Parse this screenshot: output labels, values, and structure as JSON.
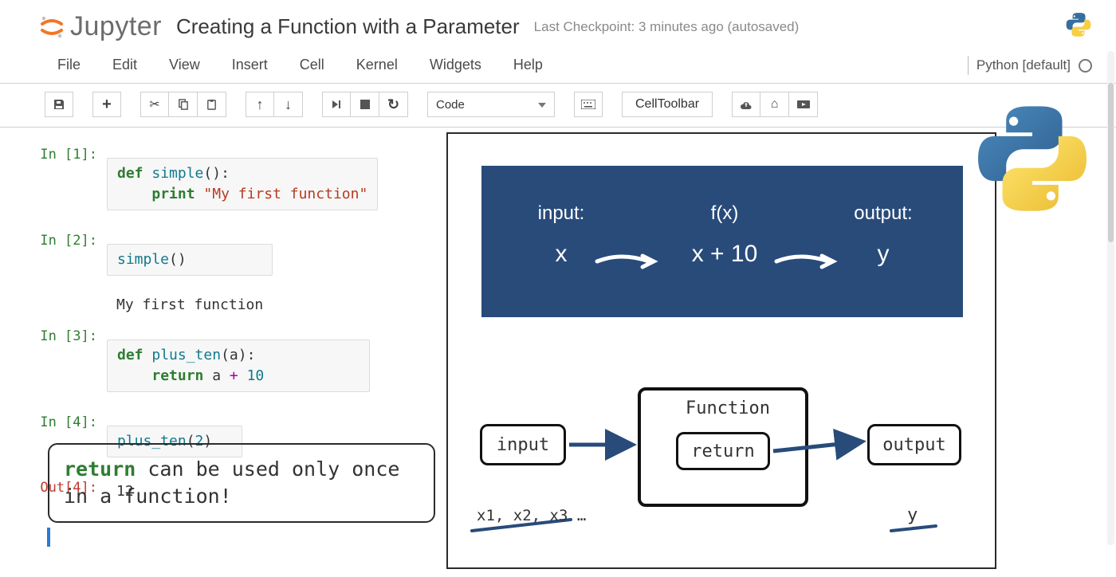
{
  "header": {
    "logo_text": "Jupyter",
    "title": "Creating a Function with a Parameter",
    "checkpoint": "Last Checkpoint: 3 minutes ago (autosaved)"
  },
  "menubar": {
    "items": [
      "File",
      "Edit",
      "View",
      "Insert",
      "Cell",
      "Kernel",
      "Widgets",
      "Help"
    ],
    "kernel_label": "Python [default]"
  },
  "toolbar": {
    "celltype": "Code",
    "celltoolbar_label": "CellToolbar",
    "icons": {
      "save": "save-icon",
      "add": "plus-icon",
      "cut": "scissors-icon",
      "copy": "copy-icon",
      "paste": "paste-icon",
      "up": "arrow-up-icon",
      "down": "arrow-down-icon",
      "run_step": "step-forward-icon",
      "stop": "stop-icon",
      "restart": "refresh-icon",
      "keyboard": "keyboard-icon",
      "cloud": "cloud-upload-icon",
      "gift": "gift-icon",
      "slides": "slides-icon"
    }
  },
  "cells": [
    {
      "prompt": "In [1]:",
      "code_html": "<span class='kw'>def</span> <span class='fn'>simple</span>():\n    <span class='kw'>print</span> <span class='str'>\"My first function\"</span>"
    },
    {
      "prompt": "In [2]:",
      "code_html": "<span class='fn'>simple</span>()",
      "output": "My first function"
    },
    {
      "prompt": "In [3]:",
      "code_html": "<span class='kw'>def</span> <span class='fn'>plus_ten</span>(a):\n    <span class='kw'>return</span> a <span class='op'>+</span> <span class='num'>10</span>"
    },
    {
      "prompt": "In [4]:",
      "code_html": "<span class='fn'>plus_ten</span>(<span class='num'>2</span>)",
      "out_prompt": "Out[4]:",
      "output": "12"
    }
  ],
  "note": {
    "keyword": "return",
    "rest": " can be used only once in a function!"
  },
  "diagram": {
    "panel": {
      "input_label": "input:",
      "input_val": "x",
      "mid_label": "f(x)",
      "mid_val": "x + 10",
      "output_label": "output:",
      "output_val": "y"
    },
    "flow": {
      "input": "input",
      "function": "Function",
      "return": "return",
      "output": "output",
      "input_sub": "x1, x2, x3 …",
      "output_sub": "y"
    }
  }
}
